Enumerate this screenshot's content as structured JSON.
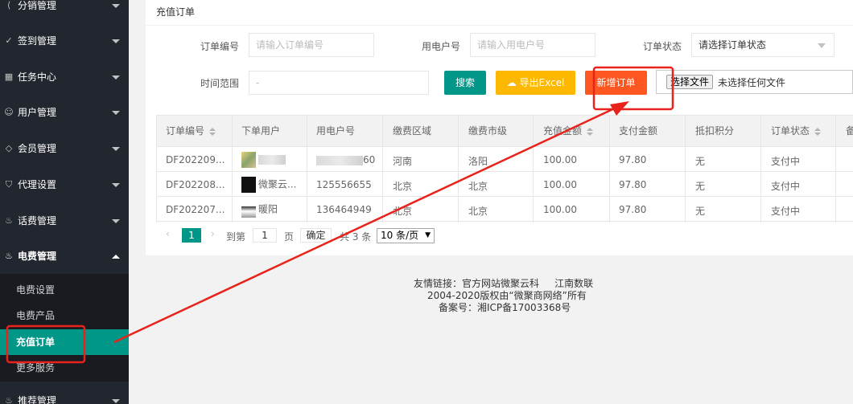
{
  "sidebar": {
    "items": [
      {
        "label": "分销管理",
        "icon": "share-icon"
      },
      {
        "label": "签到管理",
        "icon": "check-icon"
      },
      {
        "label": "任务中心",
        "icon": "grid-icon"
      },
      {
        "label": "用户管理",
        "icon": "user-icon"
      },
      {
        "label": "会员管理",
        "icon": "diamond-icon"
      },
      {
        "label": "代理设置",
        "icon": "shield-icon"
      },
      {
        "label": "话费管理",
        "icon": "fire-icon"
      },
      {
        "label": "电费管理",
        "icon": "fire-icon"
      },
      {
        "label": "推荐管理",
        "icon": "fire-icon"
      }
    ],
    "sub_items": [
      {
        "label": "电费设置"
      },
      {
        "label": "电费产品"
      },
      {
        "label": "充值订单"
      },
      {
        "label": "更多服务"
      }
    ]
  },
  "panel": {
    "title": "充值订单"
  },
  "filters": {
    "order_no_label": "订单编号",
    "order_no_placeholder": "请输入订单编号",
    "user_no_label": "用电户号",
    "user_no_placeholder": "请输入用电户号",
    "status_label": "订单状态",
    "status_value": "请选择订单状态",
    "time_label": "时间范围",
    "time_value": "-",
    "search_label": "搜索",
    "export_label": "导出Excel",
    "add_label": "新增订单",
    "file_button_label": "选择文件",
    "file_status": "未选择任何文件"
  },
  "table": {
    "headers": [
      "订单编号",
      "下单用户",
      "用电户号",
      "缴费区域",
      "缴费市级",
      "充值金额",
      "支付金额",
      "抵扣积分",
      "订单状态",
      "备"
    ],
    "rows": [
      {
        "order_no": "DF202209...",
        "user": "",
        "user_no": "60",
        "region": "河南",
        "city": "洛阳",
        "recharge": "100.00",
        "paid": "97.80",
        "points": "无",
        "status": "支付中"
      },
      {
        "order_no": "DF202208...",
        "user": "微聚云...",
        "user_no": "125556655",
        "region": "北京",
        "city": "北京",
        "recharge": "100.00",
        "paid": "97.80",
        "points": "无",
        "status": "支付中"
      },
      {
        "order_no": "DF202207...",
        "user": "暖阳",
        "user_no": "136464949",
        "region": "北京",
        "city": "北京",
        "recharge": "100.00",
        "paid": "97.80",
        "points": "无",
        "status": "支付中"
      }
    ]
  },
  "pagination": {
    "current": "1",
    "goto_prefix": "到第",
    "goto_value": "1",
    "goto_suffix": "页",
    "confirm": "确定",
    "total": "共 3 条",
    "page_size": "10 条/页"
  },
  "footer": {
    "line1": "友情链接：官方网站微聚云科     江南数联",
    "line2": "2004-2020版权由“微聚商网络”所有",
    "line3": "备案号：湘ICP备17003368号"
  },
  "colors": {
    "sidebar_bg": "#22262e",
    "accent": "#009688",
    "warning": "#ffb800",
    "danger": "#ff5722",
    "annotation": "#e8231b"
  }
}
